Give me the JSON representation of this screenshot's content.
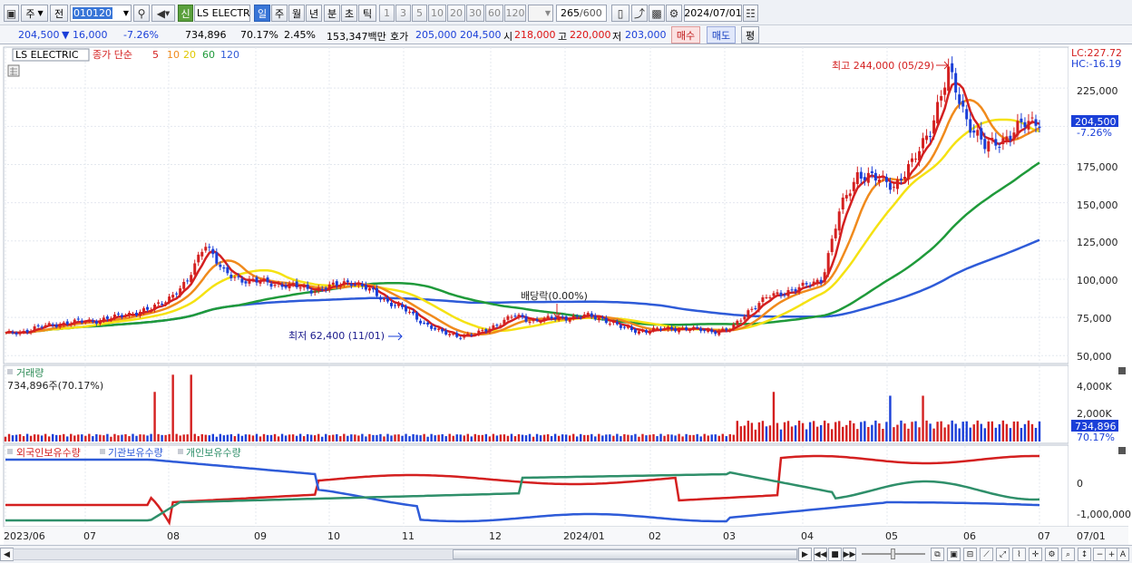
{
  "toolbar": {
    "period_type": "주",
    "prev_label": "전",
    "code": "010120",
    "credit_badge": "신",
    "stock_name": "LS ELECTRI",
    "periods": [
      "일",
      "주",
      "월",
      "년",
      "분",
      "초",
      "틱"
    ],
    "active_period": "일",
    "intervals": [
      "1",
      "3",
      "5",
      "10",
      "20",
      "30",
      "60",
      "120"
    ],
    "count": "265",
    "count_max": "/600",
    "date": "2024/07/01"
  },
  "quote": {
    "price": "204,500",
    "change": "▼ 16,000",
    "change_pct": "-7.26%",
    "volume": "734,896",
    "volume_ratio": "70.17%",
    "turnover": "2.45%",
    "amount": "153,347백만",
    "bid_label": "호가",
    "ask": "205,000",
    "bid": "204,500",
    "open_label": "시",
    "open": "218,000",
    "high_label": "고",
    "high": "220,000",
    "low_label": "저",
    "low": "203,000",
    "buy_button": "매수",
    "sell_button": "매도",
    "eval_button": "평"
  },
  "chart_data": {
    "type": "candlestick",
    "legend": {
      "name": "LS ELECTRIC",
      "ma_label": "종가 단순",
      "ma_periods": [
        {
          "period": "5",
          "color": "#d42020"
        },
        {
          "period": "10",
          "color": "#f08a1c"
        },
        {
          "period": "20",
          "color": "#f5e212"
        },
        {
          "period": "60",
          "color": "#1f9a3a"
        },
        {
          "period": "120",
          "color": "#2e5bd8"
        }
      ]
    },
    "price_axis": {
      "ticks": [
        "225,000",
        "200,000",
        "175,000",
        "150,000",
        "125,000",
        "100,000",
        "75,000",
        "50,000"
      ],
      "ylim": [
        46000,
        250000
      ]
    },
    "lc_label": "LC:227.72",
    "hc_label": "HC:-16.19",
    "current_price_label": "204,500",
    "current_change_label": "-7.26%",
    "max_annotation": "최고 244,000 (05/29)",
    "min_annotation": "최저 62,400 (11/01)",
    "dividend_annotation": "배당락(0.00%)",
    "x_labels": [
      "2023/06",
      "07",
      "08",
      "09",
      "10",
      "11",
      "12",
      "2024/01",
      "02",
      "03",
      "04",
      "05",
      "06",
      "07"
    ],
    "x_label_right": "07/01",
    "closes_approx": [
      64000,
      66000,
      69000,
      71000,
      72000,
      73000,
      75000,
      78000,
      80000,
      88000,
      97000,
      125000,
      104000,
      100000,
      98000,
      97000,
      95000,
      93000,
      95000,
      99000,
      93000,
      86000,
      80000,
      72000,
      65000,
      63000,
      64000,
      70000,
      76000,
      73000,
      74000,
      75000,
      76000,
      74000,
      68000,
      66000,
      67000,
      68000,
      67000,
      66000,
      67000,
      80000,
      88000,
      92000,
      95000,
      100000,
      145000,
      170000,
      165000,
      162000,
      175000,
      200000,
      235000,
      205000,
      186000,
      192000,
      200000,
      204500
    ],
    "volume_panel": {
      "title": "거래량",
      "value_label": "734,896주(70.17%)",
      "axis_ticks": [
        "4,000K",
        "2,000K"
      ],
      "current_label": "734,896",
      "current_pct": "70.17%"
    },
    "holdings_panel": {
      "series": [
        {
          "name": "외국인보유수량",
          "color": "#d42020"
        },
        {
          "name": "기관보유수량",
          "color": "#2e5bd8"
        },
        {
          "name": "개인보유수량",
          "color": "#2f8f6a"
        }
      ],
      "axis_ticks": [
        "0",
        "-1,000,000"
      ]
    }
  },
  "colors": {
    "up": "#d42020",
    "down": "#1a3fd8",
    "grid": "#dde2ea",
    "accent": "#3875d7"
  }
}
